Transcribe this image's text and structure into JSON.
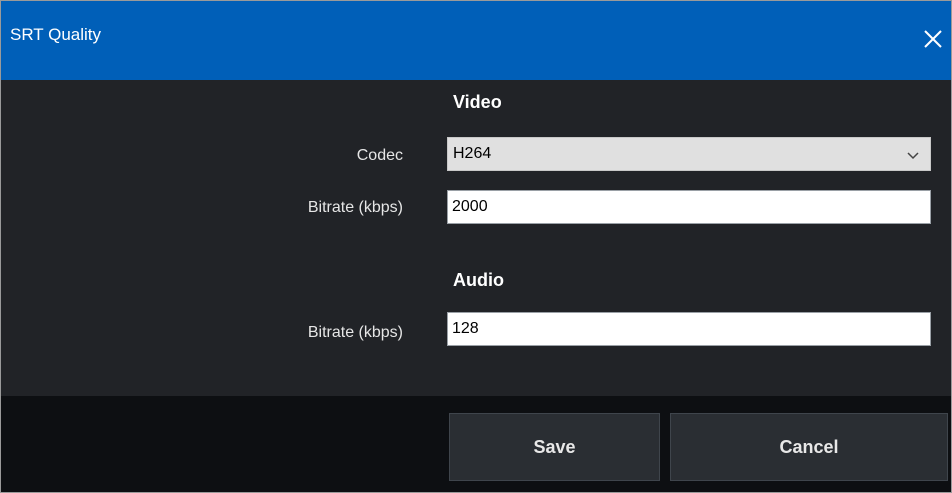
{
  "window": {
    "title": "SRT Quality"
  },
  "video": {
    "header": "Video",
    "codec_label": "Codec",
    "codec_value": "H264",
    "bitrate_label": "Bitrate (kbps)",
    "bitrate_value": "2000"
  },
  "audio": {
    "header": "Audio",
    "bitrate_label": "Bitrate (kbps)",
    "bitrate_value": "128"
  },
  "footer": {
    "save_label": "Save",
    "cancel_label": "Cancel"
  },
  "colors": {
    "titlebar": "#005fb8",
    "body": "#212327",
    "footer": "#0d0f12",
    "button": "#2a2e33"
  },
  "icons": {
    "close": "close-icon",
    "dropdown": "chevron-down-icon"
  }
}
